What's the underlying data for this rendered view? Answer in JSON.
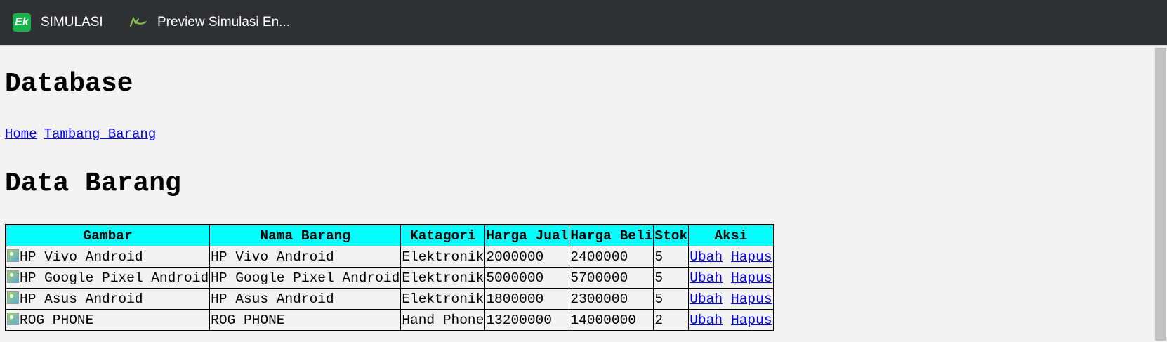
{
  "topbar": {
    "tabs": [
      {
        "label": "SIMULASI",
        "icon": "ek-logo-icon"
      },
      {
        "label": "Preview Simulasi En...",
        "icon": "simulation-icon"
      }
    ]
  },
  "page": {
    "title": "Database",
    "nav": [
      {
        "label": "Home"
      },
      {
        "label": "Tambang Barang"
      }
    ],
    "section_title": "Data Barang"
  },
  "table": {
    "headers": [
      "Gambar",
      "Nama Barang",
      "Katagori",
      "Harga Jual",
      "Harga Beli",
      "Stok",
      "Aksi"
    ],
    "rows": [
      {
        "gambar_alt": "HP Vivo Android",
        "nama": "HP Vivo Android",
        "kategori": "Elektronik",
        "harga_jual": "2000000",
        "harga_beli": "2400000",
        "stok": "5",
        "ubah": "Ubah",
        "hapus": "Hapus"
      },
      {
        "gambar_alt": "HP Google Pixel Android",
        "nama": "HP Google Pixel Android",
        "kategori": "Elektronik",
        "harga_jual": "5000000",
        "harga_beli": "5700000",
        "stok": "5",
        "ubah": "Ubah",
        "hapus": "Hapus"
      },
      {
        "gambar_alt": "HP Asus Android",
        "nama": "HP Asus Android",
        "kategori": "Elektronik",
        "harga_jual": "1800000",
        "harga_beli": "2300000",
        "stok": "5",
        "ubah": "Ubah",
        "hapus": "Hapus"
      },
      {
        "gambar_alt": "ROG PHONE",
        "nama": "ROG PHONE",
        "kategori": "Hand Phone",
        "harga_jual": "13200000",
        "harga_beli": "14000000",
        "stok": "2",
        "ubah": "Ubah",
        "hapus": "Hapus"
      }
    ]
  },
  "colors": {
    "topbar_bg": "#2f3033",
    "header_bg": "#00ffff",
    "link": "#0000ee",
    "page_bg": "#f3f3f3"
  }
}
